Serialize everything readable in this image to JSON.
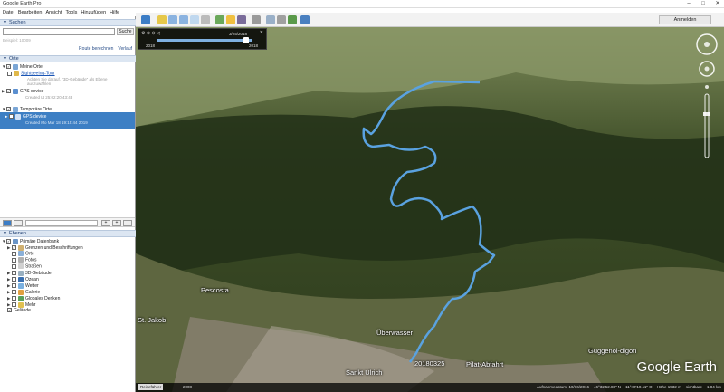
{
  "window": {
    "title": "Google Earth Pro",
    "buttons": [
      "–",
      "□",
      "✕"
    ]
  },
  "menu": [
    "Datei",
    "Bearbeiten",
    "Ansicht",
    "Tools",
    "Hinzufügen",
    "Hilfe"
  ],
  "toolbar": {
    "login_label": "Anmelden"
  },
  "search": {
    "header": "Suchen",
    "placeholder": "",
    "button_label": "Suche",
    "hint": "Beispiel: 10009",
    "route_label": "Route berechnen",
    "history_label": "Verlauf"
  },
  "places": {
    "header": "Orte",
    "items": [
      {
        "label": "Meine Orte"
      },
      {
        "label": "Sightseeing-Tour",
        "sub": "Achten Sie darauf, \"3D-Gebäude\" als Ebene auszuwählen"
      },
      {
        "label": "GPS device",
        "sub": "Created Lt 25:02:20:43:43"
      },
      {
        "label": "Temporäre Orte"
      },
      {
        "label": "GPS device",
        "sub": "Created Mo Mar 18 19:15:44 2019"
      }
    ]
  },
  "layers": {
    "header": "Ebenen",
    "items": [
      "Primäre Datenbank",
      "Grenzen und Beschriftungen",
      "Orte",
      "Fotos",
      "Straßen",
      "3D-Gebäude",
      "Ozean",
      "Wetter",
      "Galerie",
      "Globales Denken",
      "Mehr",
      "Gelände"
    ]
  },
  "timeslider": {
    "date": "3/25/2018",
    "start": "2018",
    "end": "2018"
  },
  "map": {
    "labels": {
      "pescosta": "Pescosta",
      "st_jakob": "St. Jakob",
      "uberwasser": "Überwasser",
      "track_label": "20180325",
      "pilat": "Pilat-Abfahrt",
      "guggenoi": "Guggenoi-digon",
      "sankt_ulrich": "Sankt Ulrich"
    },
    "logo": "Google Earth",
    "track_color": "#5aa2e0"
  },
  "status": {
    "tour_button": "Reiseführer",
    "year": "2008",
    "right": [
      "Aufnahmedatum: 10/16/2016",
      "46°32'52.88\" N",
      "11°40'10.11\" O",
      "Höhe 1532 m",
      "sichtbare",
      "1.84 km"
    ]
  }
}
